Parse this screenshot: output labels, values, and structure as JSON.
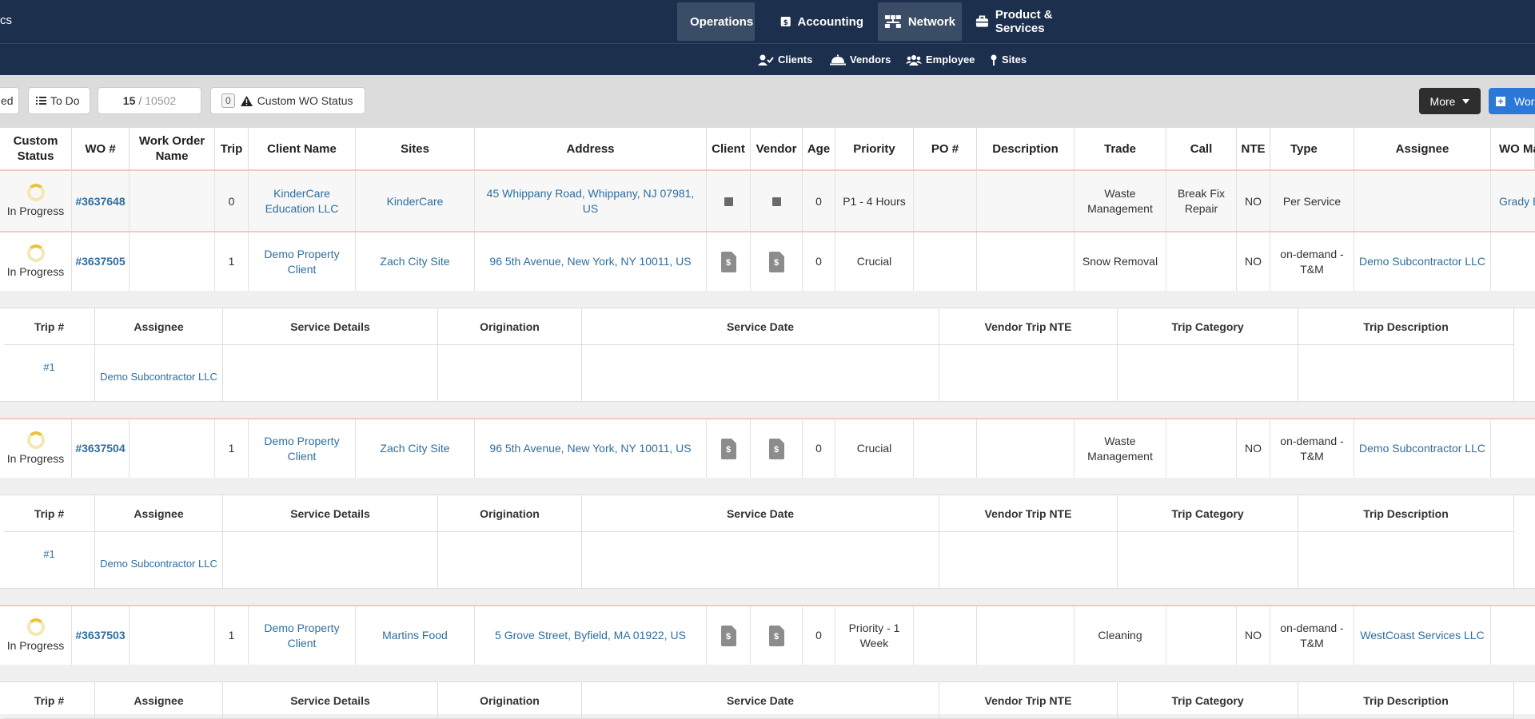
{
  "nav": {
    "brand_fragment": "cs",
    "items": [
      {
        "label": "Operations",
        "icon": "clipboard-icon"
      },
      {
        "label": "Accounting",
        "icon": "invoice-icon"
      },
      {
        "label": "Network",
        "icon": "network-icon"
      },
      {
        "label": "Product & Services",
        "icon": "briefcase-icon"
      }
    ],
    "sub_items": [
      {
        "label": "Clients",
        "icon": "user-check-icon"
      },
      {
        "label": "Vendors",
        "icon": "service-bell-icon"
      },
      {
        "label": "Employee",
        "icon": "users-icon"
      },
      {
        "label": "Sites",
        "icon": "map-pin-icon"
      }
    ]
  },
  "toolbar": {
    "filter_fragment": "ed",
    "todo_label": "To Do",
    "page_current": "15",
    "page_separator": "/",
    "page_total": "10502",
    "wo_status_count": "0",
    "wo_status_label": "Custom WO Status",
    "more_label": "More",
    "new_label": "Wor"
  },
  "table": {
    "headers": [
      "Custom Status",
      "WO #",
      "Work Order Name",
      "Trip",
      "Client Name",
      "Sites",
      "Address",
      "Client",
      "Vendor",
      "Age",
      "Priority",
      "PO #",
      "Description",
      "Trade",
      "Call",
      "NTE",
      "Type",
      "Assignee",
      "WO Ma"
    ],
    "rows": [
      {
        "status": "In Progress",
        "wo": "#3637648",
        "name": "",
        "trip": "0",
        "client": "KinderCare Education LLC",
        "site": "KinderCare",
        "address": "45 Whippany Road, Whippany, NJ 07981, US",
        "client_icon": "square",
        "vendor_icon": "square",
        "age": "0",
        "priority": "P1 - 4 Hours",
        "po": "",
        "description": "",
        "trade": "Waste Management",
        "call": "Break Fix Repair",
        "nte": "NO",
        "type": "Per Service",
        "assignee": "",
        "manager": "Grady B"
      },
      {
        "status": "In Progress",
        "wo": "#3637505",
        "name": "",
        "trip": "1",
        "client": "Demo Property Client",
        "site": "Zach City Site",
        "address": "96 5th Avenue, New York, NY 10011, US",
        "client_icon": "invoice",
        "vendor_icon": "invoice",
        "age": "0",
        "priority": "Crucial",
        "po": "",
        "description": "",
        "trade": "Snow Removal",
        "call": "",
        "nte": "NO",
        "type": "on-demand - T&M",
        "assignee": "Demo Subcontractor LLC",
        "manager": ""
      },
      {
        "status": "In Progress",
        "wo": "#3637504",
        "name": "",
        "trip": "1",
        "client": "Demo Property Client",
        "site": "Zach City Site",
        "address": "96 5th Avenue, New York, NY 10011, US",
        "client_icon": "invoice",
        "vendor_icon": "invoice",
        "age": "0",
        "priority": "Crucial",
        "po": "",
        "description": "",
        "trade": "Waste Management",
        "call": "",
        "nte": "NO",
        "type": "on-demand - T&M",
        "assignee": "Demo Subcontractor LLC",
        "manager": ""
      },
      {
        "status": "In Progress",
        "wo": "#3637503",
        "name": "",
        "trip": "1",
        "client": "Demo Property Client",
        "site": "Martins Food",
        "address": "5 Grove Street, Byfield, MA 01922, US",
        "client_icon": "invoice",
        "vendor_icon": "invoice",
        "age": "0",
        "priority": "Priority - 1 Week",
        "po": "",
        "description": "",
        "trade": "Cleaning",
        "call": "",
        "nte": "NO",
        "type": "on-demand - T&M",
        "assignee": "WestCoast Services LLC",
        "manager": ""
      }
    ],
    "invoice_symbol": "$",
    "trip_headers": [
      "Trip #",
      "Assignee",
      "Service Details",
      "Origination",
      "Service Date",
      "Vendor Trip NTE",
      "Trip Category",
      "Trip Description"
    ],
    "trips": [
      {
        "trip": "#1",
        "assignee": "Demo Subcontractor LLC"
      },
      {
        "trip": "#1",
        "assignee": "Demo Subcontractor LLC"
      }
    ]
  }
}
